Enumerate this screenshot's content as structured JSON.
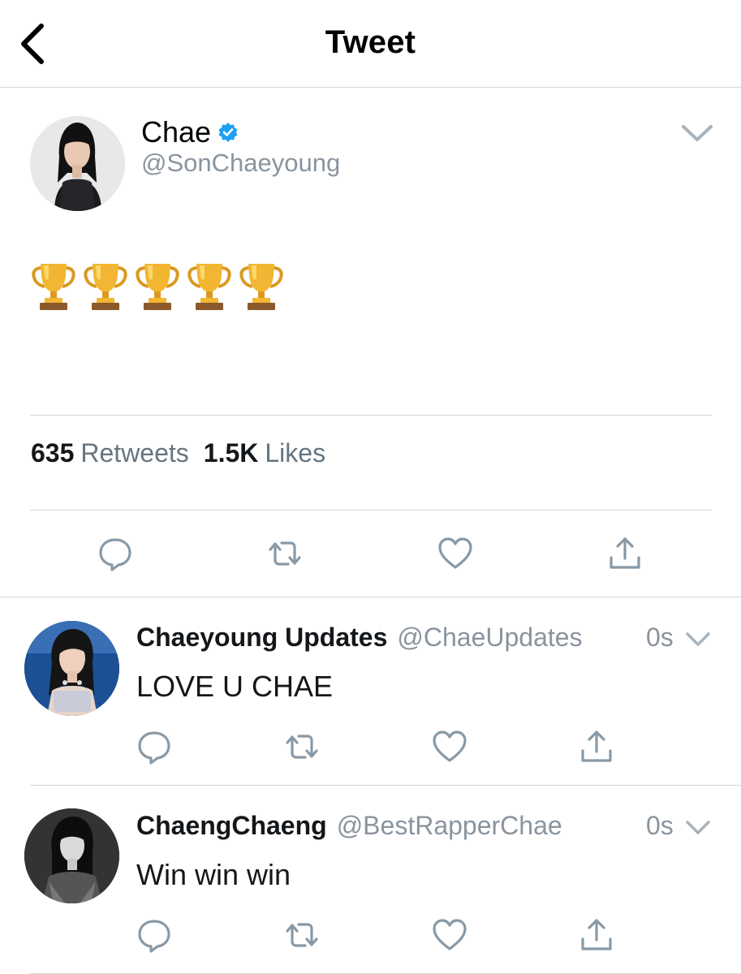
{
  "header": {
    "title": "Tweet",
    "back_icon": "chevron-left-icon"
  },
  "tweet": {
    "author_name": "Chae",
    "verified": true,
    "author_handle": "@SonChaeyoung",
    "content_emoji": [
      "trophy",
      "trophy",
      "trophy",
      "trophy",
      "trophy"
    ],
    "retweets_count": "635",
    "retweets_label": "Retweets",
    "likes_count": "1.5K",
    "likes_label": "Likes",
    "actions": [
      "reply-icon",
      "retweet-icon",
      "like-icon",
      "share-icon"
    ]
  },
  "replies": [
    {
      "name": "Chaeyoung Updates",
      "handle": "@ChaeUpdates",
      "time": "0s",
      "text": "LOVE U CHAE"
    },
    {
      "name": "ChaengChaeng",
      "handle": "@BestRapperChae",
      "time": "0s",
      "text": "Win win win"
    }
  ],
  "colors": {
    "text": "#14171a",
    "secondary": "#8a949e",
    "icon": "#8899a6",
    "verified_blue": "#1da1f2",
    "divider": "#d6d6d6"
  }
}
